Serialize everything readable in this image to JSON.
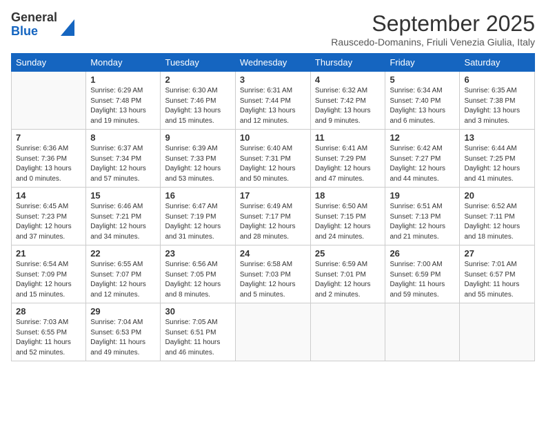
{
  "logo": {
    "general": "General",
    "blue": "Blue"
  },
  "title": "September 2025",
  "location": "Rauscedo-Domanins, Friuli Venezia Giulia, Italy",
  "days_of_week": [
    "Sunday",
    "Monday",
    "Tuesday",
    "Wednesday",
    "Thursday",
    "Friday",
    "Saturday"
  ],
  "weeks": [
    [
      {
        "day": "",
        "info": ""
      },
      {
        "day": "1",
        "info": "Sunrise: 6:29 AM\nSunset: 7:48 PM\nDaylight: 13 hours\nand 19 minutes."
      },
      {
        "day": "2",
        "info": "Sunrise: 6:30 AM\nSunset: 7:46 PM\nDaylight: 13 hours\nand 15 minutes."
      },
      {
        "day": "3",
        "info": "Sunrise: 6:31 AM\nSunset: 7:44 PM\nDaylight: 13 hours\nand 12 minutes."
      },
      {
        "day": "4",
        "info": "Sunrise: 6:32 AM\nSunset: 7:42 PM\nDaylight: 13 hours\nand 9 minutes."
      },
      {
        "day": "5",
        "info": "Sunrise: 6:34 AM\nSunset: 7:40 PM\nDaylight: 13 hours\nand 6 minutes."
      },
      {
        "day": "6",
        "info": "Sunrise: 6:35 AM\nSunset: 7:38 PM\nDaylight: 13 hours\nand 3 minutes."
      }
    ],
    [
      {
        "day": "7",
        "info": "Sunrise: 6:36 AM\nSunset: 7:36 PM\nDaylight: 13 hours\nand 0 minutes."
      },
      {
        "day": "8",
        "info": "Sunrise: 6:37 AM\nSunset: 7:34 PM\nDaylight: 12 hours\nand 57 minutes."
      },
      {
        "day": "9",
        "info": "Sunrise: 6:39 AM\nSunset: 7:33 PM\nDaylight: 12 hours\nand 53 minutes."
      },
      {
        "day": "10",
        "info": "Sunrise: 6:40 AM\nSunset: 7:31 PM\nDaylight: 12 hours\nand 50 minutes."
      },
      {
        "day": "11",
        "info": "Sunrise: 6:41 AM\nSunset: 7:29 PM\nDaylight: 12 hours\nand 47 minutes."
      },
      {
        "day": "12",
        "info": "Sunrise: 6:42 AM\nSunset: 7:27 PM\nDaylight: 12 hours\nand 44 minutes."
      },
      {
        "day": "13",
        "info": "Sunrise: 6:44 AM\nSunset: 7:25 PM\nDaylight: 12 hours\nand 41 minutes."
      }
    ],
    [
      {
        "day": "14",
        "info": "Sunrise: 6:45 AM\nSunset: 7:23 PM\nDaylight: 12 hours\nand 37 minutes."
      },
      {
        "day": "15",
        "info": "Sunrise: 6:46 AM\nSunset: 7:21 PM\nDaylight: 12 hours\nand 34 minutes."
      },
      {
        "day": "16",
        "info": "Sunrise: 6:47 AM\nSunset: 7:19 PM\nDaylight: 12 hours\nand 31 minutes."
      },
      {
        "day": "17",
        "info": "Sunrise: 6:49 AM\nSunset: 7:17 PM\nDaylight: 12 hours\nand 28 minutes."
      },
      {
        "day": "18",
        "info": "Sunrise: 6:50 AM\nSunset: 7:15 PM\nDaylight: 12 hours\nand 24 minutes."
      },
      {
        "day": "19",
        "info": "Sunrise: 6:51 AM\nSunset: 7:13 PM\nDaylight: 12 hours\nand 21 minutes."
      },
      {
        "day": "20",
        "info": "Sunrise: 6:52 AM\nSunset: 7:11 PM\nDaylight: 12 hours\nand 18 minutes."
      }
    ],
    [
      {
        "day": "21",
        "info": "Sunrise: 6:54 AM\nSunset: 7:09 PM\nDaylight: 12 hours\nand 15 minutes."
      },
      {
        "day": "22",
        "info": "Sunrise: 6:55 AM\nSunset: 7:07 PM\nDaylight: 12 hours\nand 12 minutes."
      },
      {
        "day": "23",
        "info": "Sunrise: 6:56 AM\nSunset: 7:05 PM\nDaylight: 12 hours\nand 8 minutes."
      },
      {
        "day": "24",
        "info": "Sunrise: 6:58 AM\nSunset: 7:03 PM\nDaylight: 12 hours\nand 5 minutes."
      },
      {
        "day": "25",
        "info": "Sunrise: 6:59 AM\nSunset: 7:01 PM\nDaylight: 12 hours\nand 2 minutes."
      },
      {
        "day": "26",
        "info": "Sunrise: 7:00 AM\nSunset: 6:59 PM\nDaylight: 11 hours\nand 59 minutes."
      },
      {
        "day": "27",
        "info": "Sunrise: 7:01 AM\nSunset: 6:57 PM\nDaylight: 11 hours\nand 55 minutes."
      }
    ],
    [
      {
        "day": "28",
        "info": "Sunrise: 7:03 AM\nSunset: 6:55 PM\nDaylight: 11 hours\nand 52 minutes."
      },
      {
        "day": "29",
        "info": "Sunrise: 7:04 AM\nSunset: 6:53 PM\nDaylight: 11 hours\nand 49 minutes."
      },
      {
        "day": "30",
        "info": "Sunrise: 7:05 AM\nSunset: 6:51 PM\nDaylight: 11 hours\nand 46 minutes."
      },
      {
        "day": "",
        "info": ""
      },
      {
        "day": "",
        "info": ""
      },
      {
        "day": "",
        "info": ""
      },
      {
        "day": "",
        "info": ""
      }
    ]
  ]
}
